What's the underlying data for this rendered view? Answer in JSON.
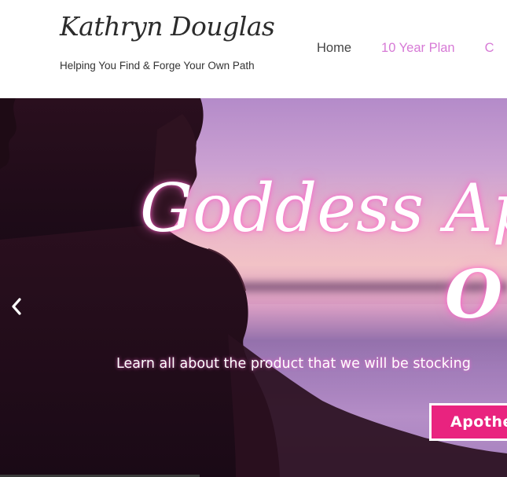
{
  "header": {
    "site_title": "Kathryn Douglas",
    "tagline": "Helping You Find & Forge Your Own Path",
    "nav": [
      {
        "label": "Home"
      },
      {
        "label": "10 Year Plan"
      },
      {
        "label": "C"
      }
    ]
  },
  "hero": {
    "title_line1": "Goddess Apo",
    "title_line2": "O",
    "subtitle": "Learn all about the product that we will be stocking",
    "button_label": "Apothe",
    "prev_icon": "chevron-left-icon"
  },
  "colors": {
    "accent_pink": "#e9237f",
    "nav_active": "#d77ad6",
    "title_dark": "#2b2b2b"
  }
}
